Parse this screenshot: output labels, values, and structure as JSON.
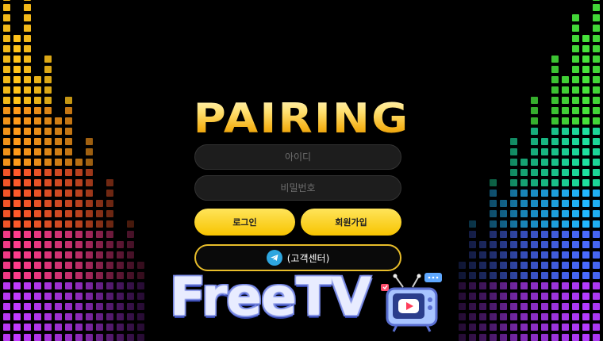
{
  "logo": {
    "text": "PAIRING"
  },
  "login_form": {
    "id_placeholder": "아이디",
    "password_placeholder": "비밀번호",
    "login_label": "로그인",
    "signup_label": "회원가입",
    "support_label": "(고객센터)"
  },
  "brand_overlay": {
    "text": "FreeTV"
  },
  "icons": {
    "support_icon": "telegram-icon",
    "tv_icon": "tv-mascot-icon"
  },
  "colors": {
    "accent": "#f7c400",
    "background": "#000000",
    "telegram": "#2ea6df"
  }
}
